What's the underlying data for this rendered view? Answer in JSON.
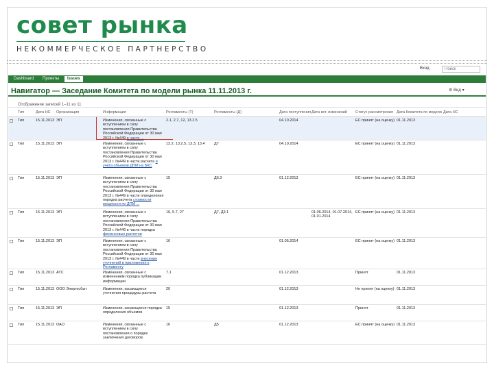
{
  "brand": {
    "logo": "совет рынка",
    "subtitle": "НЕКОММЕРЧЕСКОЕ ПАРТНЕРСТВО"
  },
  "topbar": {
    "user": "Вход",
    "search_placeholder": "Поиск"
  },
  "tabs": [
    "Dashboard",
    "Проекты",
    "Issues"
  ],
  "page_title": "Навигатор — Заседание Комитета по модели рынка 11.11.2013 г.",
  "tools": "⚙ Вид ▾",
  "subbar": "Отображение записей 1–11 из 11",
  "columns": [
    "Тип",
    "Дата НС",
    "Организация",
    "Информация",
    "Регламенты (Т)",
    "Регламенты (Д)",
    "Дата поступления",
    "Дата вст. изменений",
    "Статус рассмотрения",
    "Дата Комитета по модели",
    "Дата НС"
  ],
  "rows": [
    {
      "type": "Тип",
      "date": "15.11.2013",
      "org": "ЭП",
      "info": "Изменения, связанные с вступлением в силу постановления Правительства Российской Федерации от 30 мая 2013 г. №449",
      "info_link": "в части ...",
      "reg_t": "2.1, 2.7, 12, 13.2.5",
      "reg_d": "",
      "date_in": "04.10.2014",
      "date_change": "",
      "status": "ЕС принят (на оценку)",
      "date_cmt": "01.11.2013",
      "highlight": true
    },
    {
      "type": "Тип",
      "date": "15.11.2013",
      "org": "ЭП",
      "info": "Изменения, связанные с вступлением в силу постановления Правительства Российской Федерации от 30 мая 2013 г. №449 в части расчета",
      "info_link": "и учета объемов ДПМ на БКС",
      "reg_t": "13.2, 13.2.5, 13.3, 13.4",
      "reg_d": "Д7",
      "date_in": "04.10.2014",
      "date_change": "",
      "status": "ЕС принят (на оценку)",
      "date_cmt": "01.11.2013",
      "highlight": false
    },
    {
      "type": "Тип",
      "date": "15.11.2013",
      "org": "ЭП",
      "info": "Изменения, связанные с вступлением в силу постановления Правительства Российской Федерации от 30 мая 2013 г. №449 в части определения порядка расчета",
      "info_link": "стоимости мощности по ДПМ ...",
      "reg_t": "15",
      "reg_d": "Д6.3",
      "date_in": "01.12.2013",
      "date_change": "",
      "status": "ЕС принят (на оценку)",
      "date_cmt": "01.11.2013",
      "highlight": false
    },
    {
      "type": "Тип",
      "date": "15.11.2013",
      "org": "ЭП",
      "info": "Изменения, связанные с вступлением в силу постановления Правительства Российской Федерации от 30 мая 2013 г. №449 в части порядка",
      "info_link": "финансовых расчетов",
      "reg_t": "16, 5.7, 27",
      "reg_d": "Д7, Д3.1",
      "date_in": "",
      "date_change": "01.06.2014, 01.07.2014, 01.01.2014",
      "status": "ЕС принят (на оценку)",
      "date_cmt": "01.11.2013",
      "highlight": false
    },
    {
      "type": "Тип",
      "date": "15.11.2013",
      "org": "ЭП",
      "info": "Изменения, связанные с вступлением в силу постановления Правительства Российской Федерации от 30 мая 2013 г. №449 в части",
      "info_link": "внесения уточнений в приложения к Регламенту",
      "reg_t": "16",
      "reg_d": "",
      "date_in": "01.05.2014",
      "date_change": "",
      "status": "ЕС принят (на оценку)",
      "date_cmt": "01.11.2013",
      "highlight": false
    },
    {
      "type": "Тип",
      "date": "15.11.2013",
      "org": "АТС",
      "info": "Изменения, связанные с изменением порядка публикации информации",
      "info_link": "",
      "reg_t": "7.1",
      "reg_d": "",
      "date_in": "01.12.2013",
      "date_change": "",
      "status": "Принят",
      "date_cmt": "01.11.2013",
      "highlight": false
    },
    {
      "type": "Тип",
      "date": "15.11.2013",
      "org": "ООО Энергосбыт",
      "info": "Изменения, касающиеся уточнения процедуры расчета",
      "info_link": "",
      "reg_t": "20",
      "reg_d": "",
      "date_in": "01.12.2013",
      "date_change": "",
      "status": "Не принят (на оценку)",
      "date_cmt": "01.11.2013",
      "highlight": false
    },
    {
      "type": "Тип",
      "date": "15.11.2013",
      "org": "ЭП",
      "info": "Изменения, касающиеся порядка определения объемов",
      "info_link": "",
      "reg_t": "15",
      "reg_d": "",
      "date_in": "01.12.2013",
      "date_change": "",
      "status": "Принят",
      "date_cmt": "01.11.2013",
      "highlight": false
    },
    {
      "type": "Тип",
      "date": "15.11.2013",
      "org": "ОАО",
      "info": "Изменения, связанные с вступлением в силу постановления о порядке заключения договоров",
      "info_link": "",
      "reg_t": "16",
      "reg_d": "Д5",
      "date_in": "01.12.2013",
      "date_change": "",
      "status": "ЕС принят (на оценку)",
      "date_cmt": "01.11.2013",
      "highlight": false
    }
  ]
}
